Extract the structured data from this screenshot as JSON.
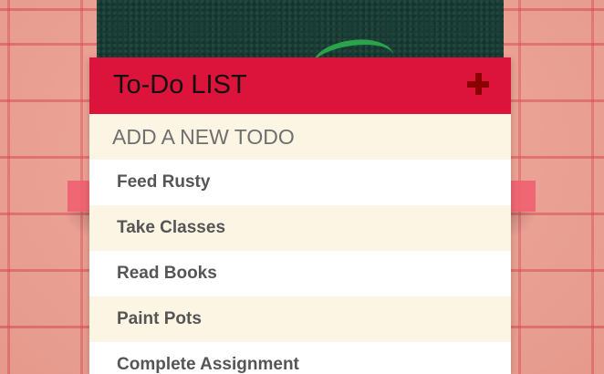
{
  "header": {
    "title": "To-Do LIST",
    "add_icon": "plus-icon"
  },
  "new_todo": {
    "placeholder": "ADD A NEW TODO"
  },
  "todos": [
    {
      "label": "Feed Rusty"
    },
    {
      "label": "Take Classes"
    },
    {
      "label": "Read Books"
    },
    {
      "label": "Paint Pots"
    },
    {
      "label": "Complete Assignment"
    }
  ],
  "colors": {
    "header": "#dc143c",
    "plus": "#8b0000",
    "alt_row": "#fdf5e4",
    "wall": "#eea091",
    "poster": "#173d34"
  }
}
